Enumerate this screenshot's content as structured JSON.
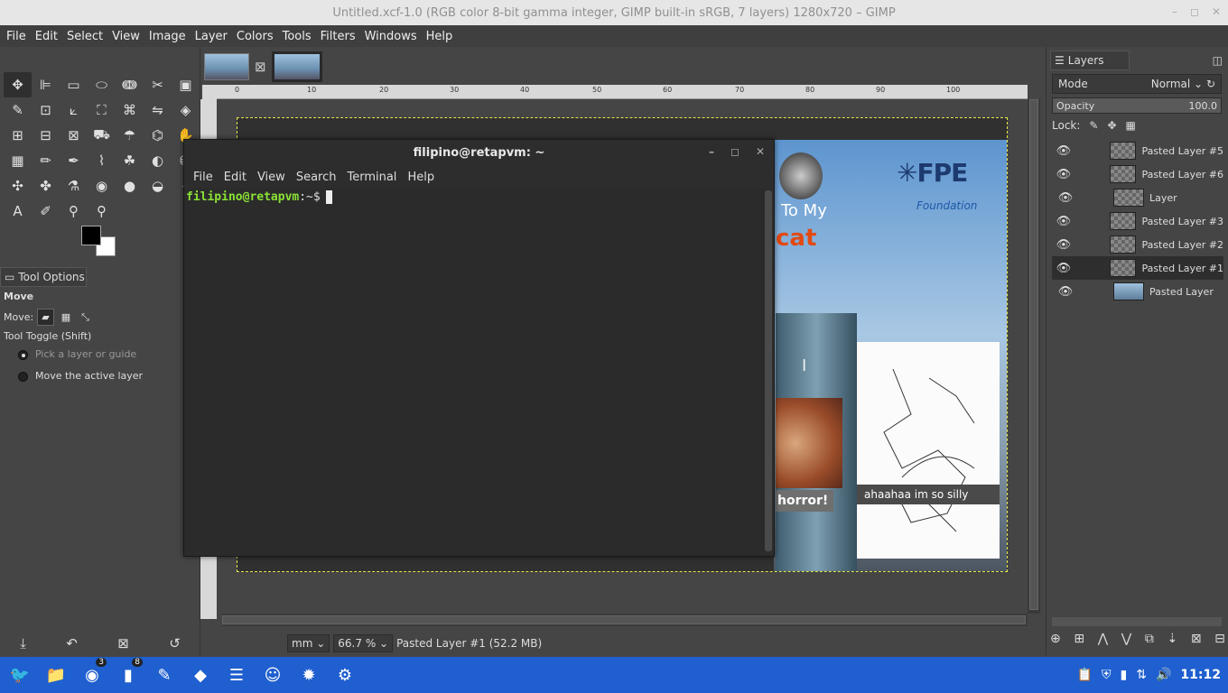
{
  "window": {
    "title": "Untitled.xcf-1.0 (RGB color 8-bit gamma integer, GIMP built-in sRGB, 7 layers) 1280x720 – GIMP",
    "controls": [
      "–",
      "◻",
      "✕"
    ]
  },
  "menubar": [
    "File",
    "Edit",
    "Select",
    "View",
    "Image",
    "Layer",
    "Colors",
    "Tools",
    "Filters",
    "Windows",
    "Help"
  ],
  "toolbox": {
    "tools": [
      "move-icon",
      "align-icon",
      "rect-select-icon",
      "ellipse-select-icon",
      "free-select-icon",
      "scissors-icon",
      "foreground-select-icon",
      "fuzzy-select-icon",
      "color-select-icon",
      "crop-icon",
      "unified-transform-icon",
      "warp-icon",
      "flip-icon",
      "cage-icon",
      "handle-transform-icon",
      "perspective-clone-icon",
      "text-align-icon",
      "bucket-fill-icon",
      "paint-icon",
      "blend-icon",
      "smudge-icon",
      "gradient-icon",
      "paintbrush-icon",
      "pencil-icon",
      "airbrush-icon",
      "ink-icon",
      "mypaint-icon",
      "heal-icon",
      "clone-icon",
      "heal-brush-icon",
      "eraser-icon",
      "smudge2-icon",
      "dodge-icon",
      "burn-icon",
      "path-icon",
      "text-icon",
      "color-picker-icon",
      "measure-icon",
      "zoom-icon"
    ],
    "tool_glyphs": [
      "✥",
      "⊫",
      "▭",
      "⬭",
      "ↈ",
      "✂",
      "▣",
      "✎",
      "⊡",
      "⟀",
      "⛶",
      "⌘",
      "⇋",
      "◈",
      "⊞",
      "⊟",
      "⊠",
      "⛟",
      "☂",
      "⌬",
      "✋",
      "▦",
      "✏",
      "✒",
      "⌇",
      "☘",
      "◐",
      "⛁",
      "✣",
      "✤",
      "⚗",
      "◉",
      "●",
      "◒",
      "⌖",
      "A",
      "✐",
      "⚲",
      "⚲"
    ],
    "tool_options_tab": "Tool Options",
    "heading": "Move",
    "move_label": "Move:",
    "toggle_label": "Tool Toggle  (Shift)",
    "opt1": "Pick a layer or guide",
    "opt2": "Move the active layer",
    "bottom": [
      "⤓",
      "↶",
      "⊠",
      "↺"
    ]
  },
  "canvas": {
    "ruler_labels": [
      "0",
      "10",
      "20",
      "30",
      "40",
      "50",
      "60",
      "70",
      "80",
      "90",
      "100"
    ],
    "image_text": {
      "to_my": "To My",
      "cat": "cat",
      "fpe": "FPE",
      "fpe_sub": "Foundation",
      "horror": "horror!",
      "silly": "ahaahaa im so silly"
    },
    "status": {
      "unit": "mm",
      "zoom": "66.7 %",
      "info": "Pasted Layer #1 (52.2 MB)"
    }
  },
  "terminal": {
    "title": "filipino@retapvm: ~",
    "controls": [
      "–",
      "◻",
      "✕"
    ],
    "menu": [
      "File",
      "Edit",
      "View",
      "Search",
      "Terminal",
      "Help"
    ],
    "prompt_user": "filipino@retapvm",
    "prompt_rest": ":~$"
  },
  "layers": {
    "tab": "Layers",
    "mode_label": "Mode",
    "mode_value": "Normal",
    "opacity_label": "Opacity",
    "opacity_value": "100.0",
    "lock_label": "Lock:",
    "items": [
      {
        "name": "Pasted Layer #5",
        "selected": false,
        "photo": false
      },
      {
        "name": "Pasted Layer #6",
        "selected": false,
        "photo": false
      },
      {
        "name": "Layer",
        "selected": false,
        "photo": false
      },
      {
        "name": "Pasted Layer #3",
        "selected": false,
        "photo": false
      },
      {
        "name": "Pasted Layer #2",
        "selected": false,
        "photo": false
      },
      {
        "name": "Pasted Layer #1",
        "selected": true,
        "photo": false
      },
      {
        "name": "Pasted Layer",
        "selected": false,
        "photo": true
      }
    ],
    "bottom": [
      "⊕",
      "⊞",
      "⋀",
      "⋁",
      "⧉",
      "⇣",
      "⊠",
      "⊟"
    ]
  },
  "taskbar": {
    "apps": [
      {
        "name": "angry-bird-icon",
        "glyph": "🐦",
        "badge": ""
      },
      {
        "name": "files-icon",
        "glyph": "📁",
        "badge": ""
      },
      {
        "name": "firefox-icon",
        "glyph": "◉",
        "badge": "3"
      },
      {
        "name": "terminal-icon",
        "glyph": "▮",
        "badge": "8"
      },
      {
        "name": "paint-icon",
        "glyph": "✎",
        "badge": ""
      },
      {
        "name": "gimp-icon",
        "glyph": "◆",
        "badge": ""
      },
      {
        "name": "text-editor-icon",
        "glyph": "☰",
        "badge": ""
      },
      {
        "name": "smiley-icon",
        "glyph": "☺",
        "badge": ""
      },
      {
        "name": "bug-icon",
        "glyph": "✹",
        "badge": ""
      },
      {
        "name": "settings-icon",
        "glyph": "⚙",
        "badge": ""
      }
    ],
    "time": "11:12"
  }
}
